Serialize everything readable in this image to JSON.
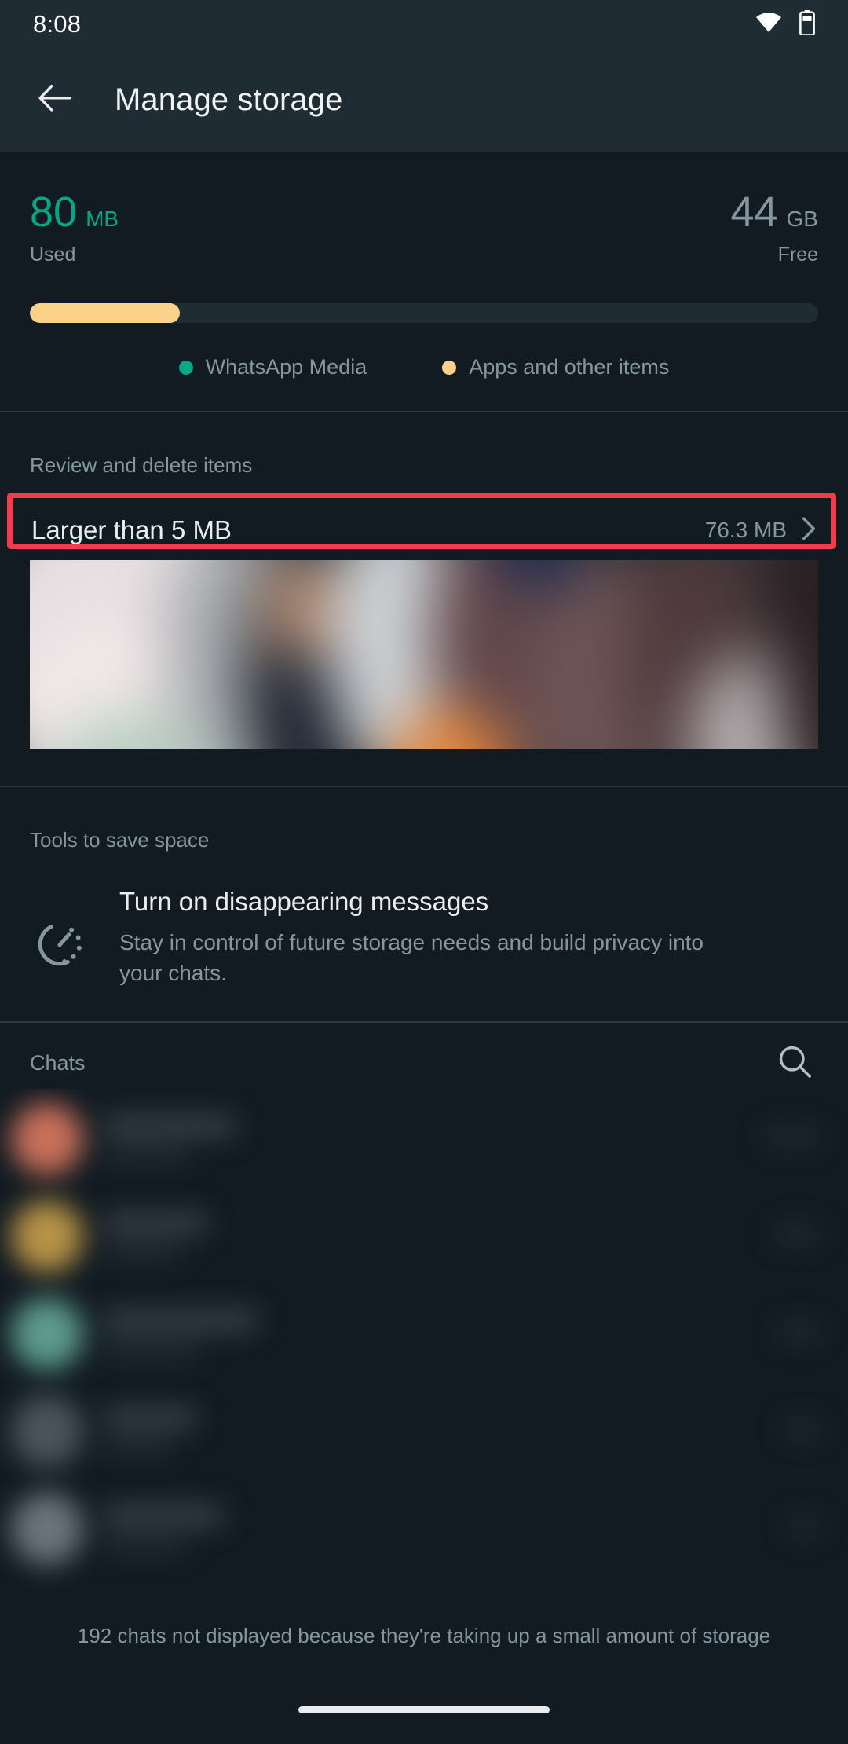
{
  "status_bar": {
    "time": "8:08",
    "icons": [
      "wifi-icon",
      "battery-icon"
    ]
  },
  "app_bar": {
    "back_icon": "back-arrow-icon",
    "title": "Manage storage"
  },
  "summary": {
    "used": {
      "value": "80",
      "unit": "MB",
      "label": "Used",
      "color": "#00A884"
    },
    "free": {
      "value": "44",
      "unit": "GB",
      "label": "Free",
      "color": "#8696A0"
    },
    "progress": {
      "fill_percent": 19,
      "fill_color": "#FCD28A",
      "track_color": "#202C33"
    },
    "legend": [
      {
        "label": "WhatsApp Media",
        "color": "#00A884"
      },
      {
        "label": "Apps and other items",
        "color": "#FCD28A"
      }
    ]
  },
  "review": {
    "header": "Review and delete items",
    "row": {
      "label": "Larger than 5 MB",
      "size": "76.3 MB",
      "chevron_icon": "chevron-right-icon"
    },
    "highlight_color": "#F23B4C"
  },
  "tools": {
    "header": "Tools to save space",
    "item": {
      "icon": "disappearing-messages-timer-icon",
      "title": "Turn on disappearing messages",
      "description": "Stay in control of future storage needs and build privacy into your chats."
    }
  },
  "chats": {
    "header": "Chats",
    "search_icon": "search-icon",
    "rows": [
      {
        "avatar_color": "#c9705a",
        "name_w": 168,
        "sub_w": 108,
        "size_w": 70
      },
      {
        "avatar_color": "#b89347",
        "name_w": 132,
        "sub_w": 96,
        "size_w": 58
      },
      {
        "avatar_color": "#5d9b8c",
        "name_w": 196,
        "sub_w": 122,
        "size_w": 52
      },
      {
        "avatar_color": "#4a545c",
        "name_w": 118,
        "sub_w": 86,
        "size_w": 46
      },
      {
        "avatar_color": "#6b747c",
        "name_w": 152,
        "sub_w": 104,
        "size_w": 40
      }
    ],
    "footer_note": "192 chats not displayed because they're taking up a small amount of storage"
  }
}
